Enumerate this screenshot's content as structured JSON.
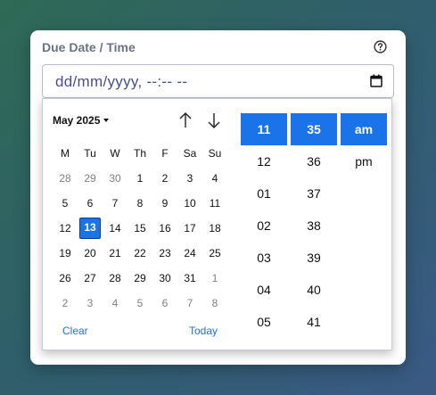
{
  "field": {
    "label": "Due Date / Time",
    "input_value": "dd/mm/yyyy, --:-- --"
  },
  "calendar": {
    "month_label": "May 2025",
    "weekdays": [
      "M",
      "Tu",
      "W",
      "Th",
      "F",
      "Sa",
      "Su"
    ],
    "weeks": [
      [
        {
          "d": "28",
          "o": true
        },
        {
          "d": "29",
          "o": true
        },
        {
          "d": "30",
          "o": true
        },
        {
          "d": "1"
        },
        {
          "d": "2"
        },
        {
          "d": "3"
        },
        {
          "d": "4"
        }
      ],
      [
        {
          "d": "5"
        },
        {
          "d": "6"
        },
        {
          "d": "7"
        },
        {
          "d": "8"
        },
        {
          "d": "9"
        },
        {
          "d": "10"
        },
        {
          "d": "11"
        }
      ],
      [
        {
          "d": "12"
        },
        {
          "d": "13",
          "sel": true
        },
        {
          "d": "14"
        },
        {
          "d": "15"
        },
        {
          "d": "16"
        },
        {
          "d": "17"
        },
        {
          "d": "18"
        }
      ],
      [
        {
          "d": "19"
        },
        {
          "d": "20"
        },
        {
          "d": "21"
        },
        {
          "d": "22"
        },
        {
          "d": "23"
        },
        {
          "d": "24"
        },
        {
          "d": "25"
        }
      ],
      [
        {
          "d": "26"
        },
        {
          "d": "27"
        },
        {
          "d": "28"
        },
        {
          "d": "29"
        },
        {
          "d": "30"
        },
        {
          "d": "31"
        },
        {
          "d": "1",
          "o": true
        }
      ],
      [
        {
          "d": "2",
          "o": true
        },
        {
          "d": "3",
          "o": true
        },
        {
          "d": "4",
          "o": true
        },
        {
          "d": "5",
          "o": true
        },
        {
          "d": "6",
          "o": true
        },
        {
          "d": "7",
          "o": true
        },
        {
          "d": "8",
          "o": true
        }
      ]
    ],
    "clear_label": "Clear",
    "today_label": "Today"
  },
  "time": {
    "hour_selected": "11",
    "minute_selected": "35",
    "ampm_selected": "am",
    "hours": [
      "12",
      "01",
      "02",
      "03",
      "04",
      "05"
    ],
    "minutes": [
      "36",
      "37",
      "38",
      "39",
      "40",
      "41"
    ],
    "ampm_options": [
      "pm"
    ]
  },
  "colors": {
    "accent": "#1a73e8",
    "label": "#6b7280",
    "input_text": "#4a4f8a"
  },
  "icons": {
    "help": "question-circle-icon",
    "calendar": "calendar-icon",
    "up": "arrow-up-icon",
    "down": "arrow-down-icon",
    "dropdown": "caret-down-icon"
  }
}
